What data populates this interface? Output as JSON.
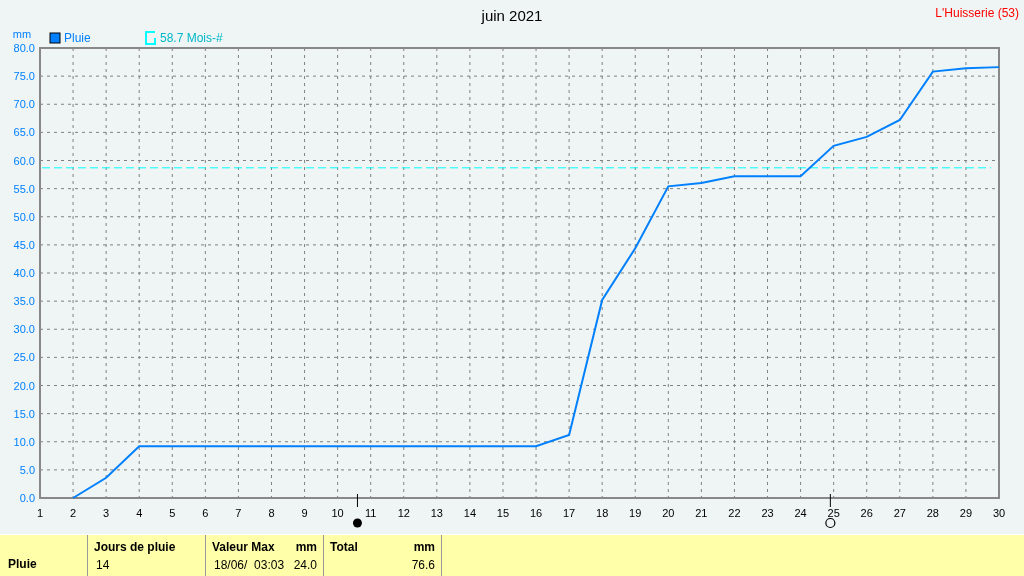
{
  "title": "juin 2021",
  "location": "L'Huisserie (53)",
  "chart_data": {
    "type": "line",
    "ylabel": "mm",
    "x": [
      2,
      3,
      4,
      5,
      6,
      7,
      8,
      9,
      10,
      11,
      12,
      13,
      14,
      15,
      16,
      17,
      18,
      19,
      20,
      21,
      22,
      23,
      24,
      25,
      26,
      27,
      28,
      29,
      30
    ],
    "series": [
      {
        "name": "Pluie",
        "color": "#0080ff",
        "values": [
          0,
          3.6,
          9.2,
          9.2,
          9.2,
          9.2,
          9.2,
          9.2,
          9.2,
          9.2,
          9.2,
          9.2,
          9.2,
          9.2,
          9.2,
          11.2,
          35.2,
          44.4,
          55.4,
          56.0,
          57.2,
          57.2,
          57.2,
          62.6,
          64.2,
          67.2,
          75.8,
          76.4,
          76.6
        ]
      }
    ],
    "ref_lines": [
      {
        "axis": "y",
        "value": 58.7,
        "color": "#00ffff",
        "label": "58.7 Mois-#"
      }
    ],
    "grid": true,
    "legend": true,
    "xlim": [
      1,
      30
    ],
    "ylim": [
      0,
      80
    ],
    "xticks": [
      1,
      2,
      3,
      4,
      5,
      6,
      7,
      8,
      9,
      10,
      11,
      12,
      13,
      14,
      15,
      16,
      17,
      18,
      19,
      20,
      21,
      22,
      23,
      24,
      25,
      26,
      27,
      28,
      29,
      30
    ],
    "yticks": [
      {
        "value": 0,
        "label": "0.0"
      },
      {
        "value": 5,
        "label": "5.0"
      },
      {
        "value": 10,
        "label": "10.0"
      },
      {
        "value": 15,
        "label": "15.0"
      },
      {
        "value": 20,
        "label": "20.0"
      },
      {
        "value": 25,
        "label": "25.0"
      },
      {
        "value": 30,
        "label": "30.0"
      },
      {
        "value": 35,
        "label": "35.0"
      },
      {
        "value": 40,
        "label": "40.0"
      },
      {
        "value": 45,
        "label": "45.0"
      },
      {
        "value": 50,
        "label": "50.0"
      },
      {
        "value": 55,
        "label": "55.0"
      },
      {
        "value": 60,
        "label": "60.0"
      },
      {
        "value": 65,
        "label": "65.0"
      },
      {
        "value": 70,
        "label": "70.0"
      },
      {
        "value": 75,
        "label": "75.0"
      },
      {
        "value": 80,
        "label": "80.0"
      }
    ]
  },
  "moon_phases": [
    {
      "kind": "new"
    },
    {
      "kind": "full"
    }
  ],
  "summary": {
    "row_label": "Pluie",
    "columns": [
      {
        "heading": "Jours de pluie",
        "value": "14"
      },
      {
        "heading": "Valeur Max",
        "unit": "mm",
        "value": "18/06/  03:03",
        "amount": "24.0"
      },
      {
        "heading": "Total",
        "unit": "mm",
        "amount": "76.6"
      }
    ]
  }
}
